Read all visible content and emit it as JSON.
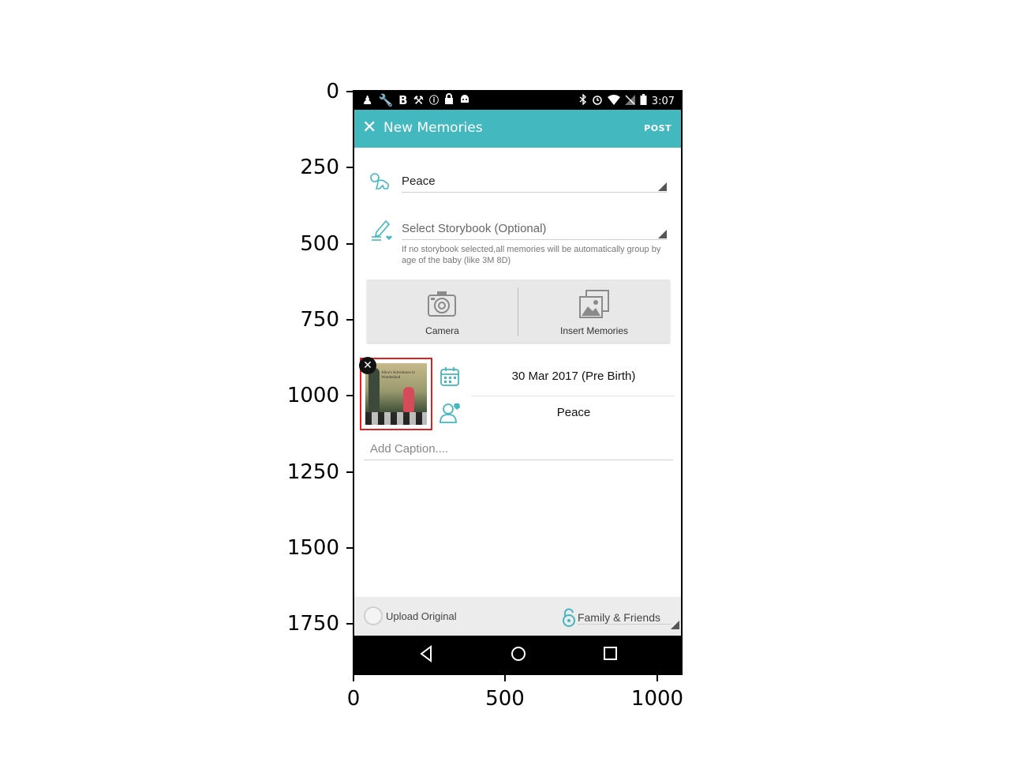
{
  "axes": {
    "y_ticks": [
      "0",
      "250",
      "500",
      "750",
      "1000",
      "1250",
      "1500",
      "1750"
    ],
    "x_ticks": [
      "0",
      "500",
      "1000"
    ]
  },
  "status_bar": {
    "time": "3:07",
    "left_icons": [
      "figure-icon",
      "wrench-icon",
      "b-icon",
      "wrench-crossed-icon",
      "info-icon",
      "lock-icon",
      "android-icon"
    ],
    "right_icons": [
      "bluetooth-icon",
      "alarm-icon",
      "wifi-icon",
      "no-signal-icon",
      "battery-icon"
    ]
  },
  "app_bar": {
    "title": "New Memories",
    "post_label": "POST",
    "color": "#44b8bf"
  },
  "baby_select": {
    "value": "Peace",
    "icon": "baby-icon"
  },
  "storybook_select": {
    "placeholder": "Select Storybook (Optional)",
    "icon": "pencil-heart-icon",
    "hint": "If no storybook selected,all memories will be automatically group by age of the baby (like 3M 8D)"
  },
  "media": {
    "camera_label": "Camera",
    "insert_label": "Insert Memories"
  },
  "photo_thumbnail": {
    "thumbnail_text": "Alice's Adventures in Wonderland"
  },
  "memory_meta": {
    "date": "30 Mar 2017 (Pre Birth)",
    "person": "Peace"
  },
  "caption": {
    "placeholder": "Add Caption...."
  },
  "bottom_bar": {
    "upload_label": "Upload Original",
    "privacy_label": "Family & Friends"
  }
}
